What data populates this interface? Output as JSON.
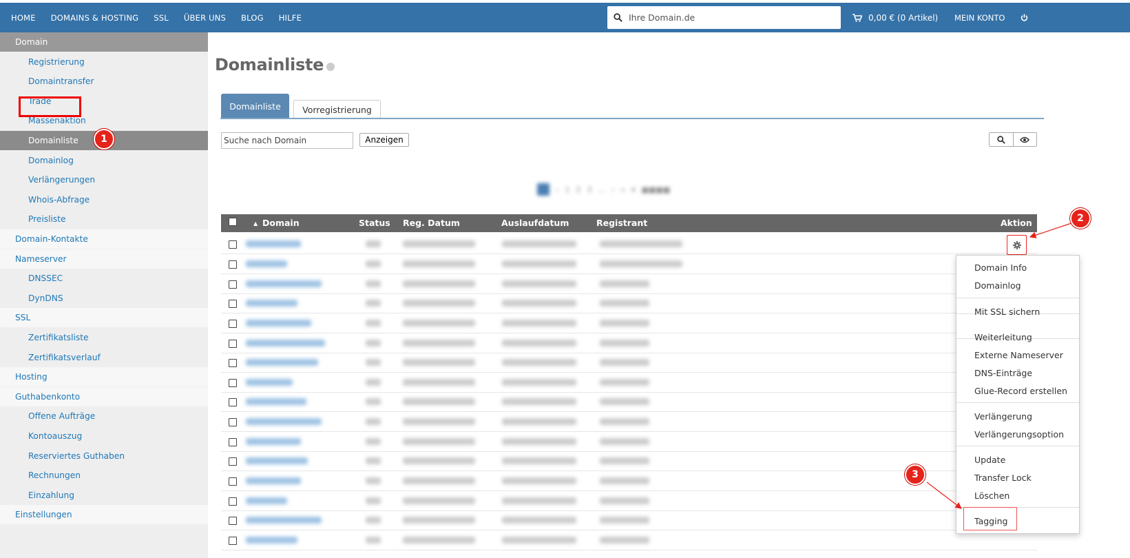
{
  "topnav": {
    "items": [
      "HOME",
      "DOMAINS & HOSTING",
      "SSL",
      "ÜBER UNS",
      "BLOG",
      "HILFE"
    ],
    "search_placeholder": "Ihre Domain.de",
    "cart": "0,00 € (0 Artikel)",
    "account": "MEIN KONTO"
  },
  "sidebar": {
    "items": [
      {
        "label": "Domain",
        "level": 1,
        "state": "header"
      },
      {
        "label": "Registrierung",
        "level": 2
      },
      {
        "label": "Domaintransfer",
        "level": 2
      },
      {
        "label": "Trade",
        "level": 2
      },
      {
        "label": "Massenaktion",
        "level": 2
      },
      {
        "label": "Domainliste",
        "level": 2,
        "state": "active"
      },
      {
        "label": "Domainlog",
        "level": 2
      },
      {
        "label": "Verlängerungen",
        "level": 2
      },
      {
        "label": "Whois-Abfrage",
        "level": 2
      },
      {
        "label": "Preisliste",
        "level": 2
      },
      {
        "label": "Domain-Kontakte",
        "level": 1
      },
      {
        "label": "Nameserver",
        "level": 1
      },
      {
        "label": "DNSSEC",
        "level": 2
      },
      {
        "label": "DynDNS",
        "level": 2
      },
      {
        "label": "SSL",
        "level": 1
      },
      {
        "label": "Zertifikatsliste",
        "level": 2
      },
      {
        "label": "Zertifikatsverlauf",
        "level": 2
      },
      {
        "label": "Hosting",
        "level": 1
      },
      {
        "label": "Guthabenkonto",
        "level": 1
      },
      {
        "label": "Offene Aufträge",
        "level": 2
      },
      {
        "label": "Kontoauszug",
        "level": 2
      },
      {
        "label": "Reserviertes Guthaben",
        "level": 2
      },
      {
        "label": "Rechnungen",
        "level": 2
      },
      {
        "label": "Einzahlung",
        "level": 2
      },
      {
        "label": "Einstellungen",
        "level": 1
      }
    ]
  },
  "main": {
    "title": "Domainliste",
    "tabs": [
      "Domainliste",
      "Vorregistrierung"
    ],
    "filter_placeholder": "Suche nach Domain",
    "show_button": "Anzeigen",
    "columns": [
      "Domain",
      "Status",
      "Reg. Datum",
      "Auslaufdatum",
      "Registrant",
      "Aktion"
    ]
  },
  "dropdown": {
    "groups": [
      [
        "Domain Info",
        "Domainlog"
      ],
      [
        "Mit SSL sichern"
      ],
      [
        "Weiterleitung",
        "Externe Nameserver",
        "DNS-Einträge",
        "Glue-Record erstellen"
      ],
      [
        "Verlängerung",
        "Verlängerungsoption"
      ],
      [
        "Update",
        "Transfer Lock",
        "Löschen"
      ],
      [
        "Tagging"
      ]
    ]
  },
  "annotations": [
    "1",
    "2",
    "3"
  ],
  "colors": {
    "nav": "#3572a8",
    "link": "#1f78b7",
    "marker": "#e5231b",
    "table_header": "#666666"
  }
}
